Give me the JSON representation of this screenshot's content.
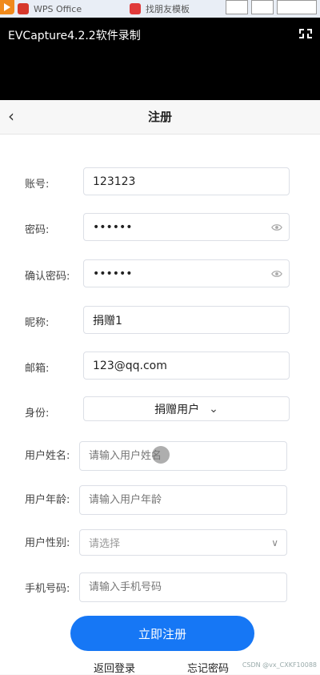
{
  "taskbar": {
    "apps": [
      {
        "label": "WPS Office",
        "icon": "wps-icon",
        "color": "#d6382b"
      },
      {
        "label": "找朋友模板",
        "icon": "acrobat-icon",
        "color": "#e03a3a"
      }
    ]
  },
  "recorder": {
    "title": "EVCapture4.2.2软件录制"
  },
  "header": {
    "title": "注册"
  },
  "form": {
    "account": {
      "label": "账号:",
      "value": "123123"
    },
    "password": {
      "label": "密码:",
      "value": "••••••"
    },
    "confirm_password": {
      "label": "确认密码:",
      "value": "••••••"
    },
    "nickname": {
      "label": "昵称:",
      "value": "捐赠1"
    },
    "email": {
      "label": "邮箱:",
      "value": "123@qq.com"
    },
    "role": {
      "label": "身份:",
      "value": "捐赠用户"
    },
    "user_name": {
      "label": "用户姓名:",
      "placeholder": "请输入用户姓名"
    },
    "user_age": {
      "label": "用户年龄:",
      "placeholder": "请输入用户年龄"
    },
    "user_gender": {
      "label": "用户性别:",
      "placeholder": "请选择"
    },
    "phone": {
      "label": "手机号码:",
      "placeholder": "请输入手机号码"
    }
  },
  "actions": {
    "register": "立即注册",
    "back_login": "返回登录",
    "forgot_password": "忘记密码"
  },
  "watermark": "CSDN @vx_CXKF10088",
  "colors": {
    "primary": "#1677f5",
    "recorder_bg": "#000000"
  }
}
